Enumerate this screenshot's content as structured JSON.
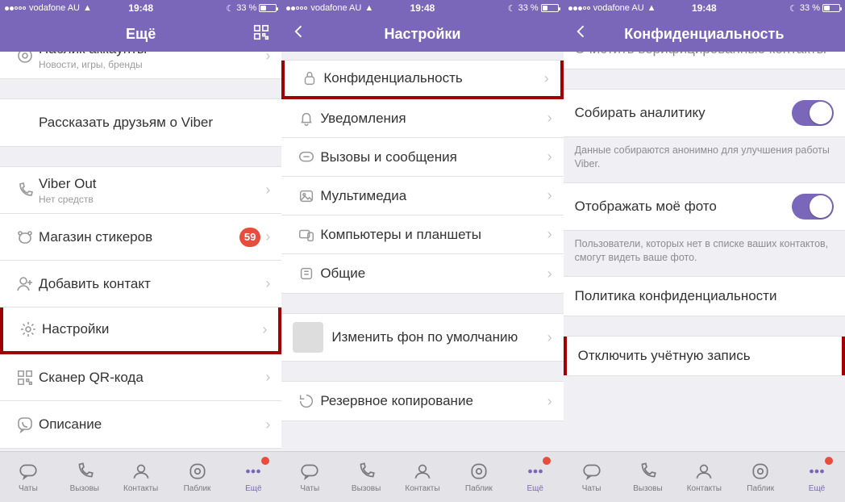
{
  "status": {
    "carrier": "vodafone AU",
    "time": "19:48",
    "battery": "33 %"
  },
  "screens": [
    {
      "title": "Ещё",
      "partial_top": {
        "title": "Паблик аккаунты",
        "sub": "Новости, игры, бренды"
      },
      "groups": [
        [
          {
            "label": "Рассказать друзьям о Viber",
            "icon": null
          }
        ],
        [
          {
            "label": "Viber Out",
            "sub": "Нет средств",
            "icon": "phone"
          },
          {
            "label": "Магазин стикеров",
            "icon": "bear",
            "badge": "59"
          },
          {
            "label": "Добавить контакт",
            "icon": "adduser"
          },
          {
            "label": "Настройки",
            "icon": "gear",
            "highlight": true
          },
          {
            "label": "Сканер QR-кода",
            "icon": "qr"
          },
          {
            "label": "Описание",
            "icon": "viber"
          }
        ]
      ]
    },
    {
      "title": "Настройки",
      "groups": [
        [
          {
            "label": "Конфиденциальность",
            "icon": "lock",
            "highlight": true
          },
          {
            "label": "Уведомления",
            "icon": "bell"
          },
          {
            "label": "Вызовы и сообщения",
            "icon": "chat"
          },
          {
            "label": "Мультимедиа",
            "icon": "image"
          },
          {
            "label": "Компьютеры и планшеты",
            "icon": "devices"
          },
          {
            "label": "Общие",
            "icon": "general"
          }
        ],
        [
          {
            "label": "Изменить фон по умолчанию",
            "icon": null,
            "thumb": true
          }
        ],
        [
          {
            "label": "Резервное копирование",
            "icon": "backup"
          }
        ]
      ]
    },
    {
      "title": "Конфиденциальность",
      "partial_top": {
        "title": "Очистить верифицированные контакты"
      },
      "rows": [
        {
          "label": "Собирать аналитику",
          "toggle": true,
          "footer": "Данные собираются анонимно для улучшения работы Viber."
        },
        {
          "label": "Отображать моё фото",
          "toggle": true,
          "footer": "Пользователи, которых нет в списке ваших контактов, смогут видеть ваше фото."
        },
        {
          "label": "Политика конфиденциальности"
        },
        {
          "label": "Отключить учётную запись",
          "highlight": true
        }
      ]
    }
  ],
  "tabs": {
    "chats": "Чаты",
    "calls": "Вызовы",
    "contacts": "Контакты",
    "public": "Паблик",
    "more": "Ещё"
  }
}
